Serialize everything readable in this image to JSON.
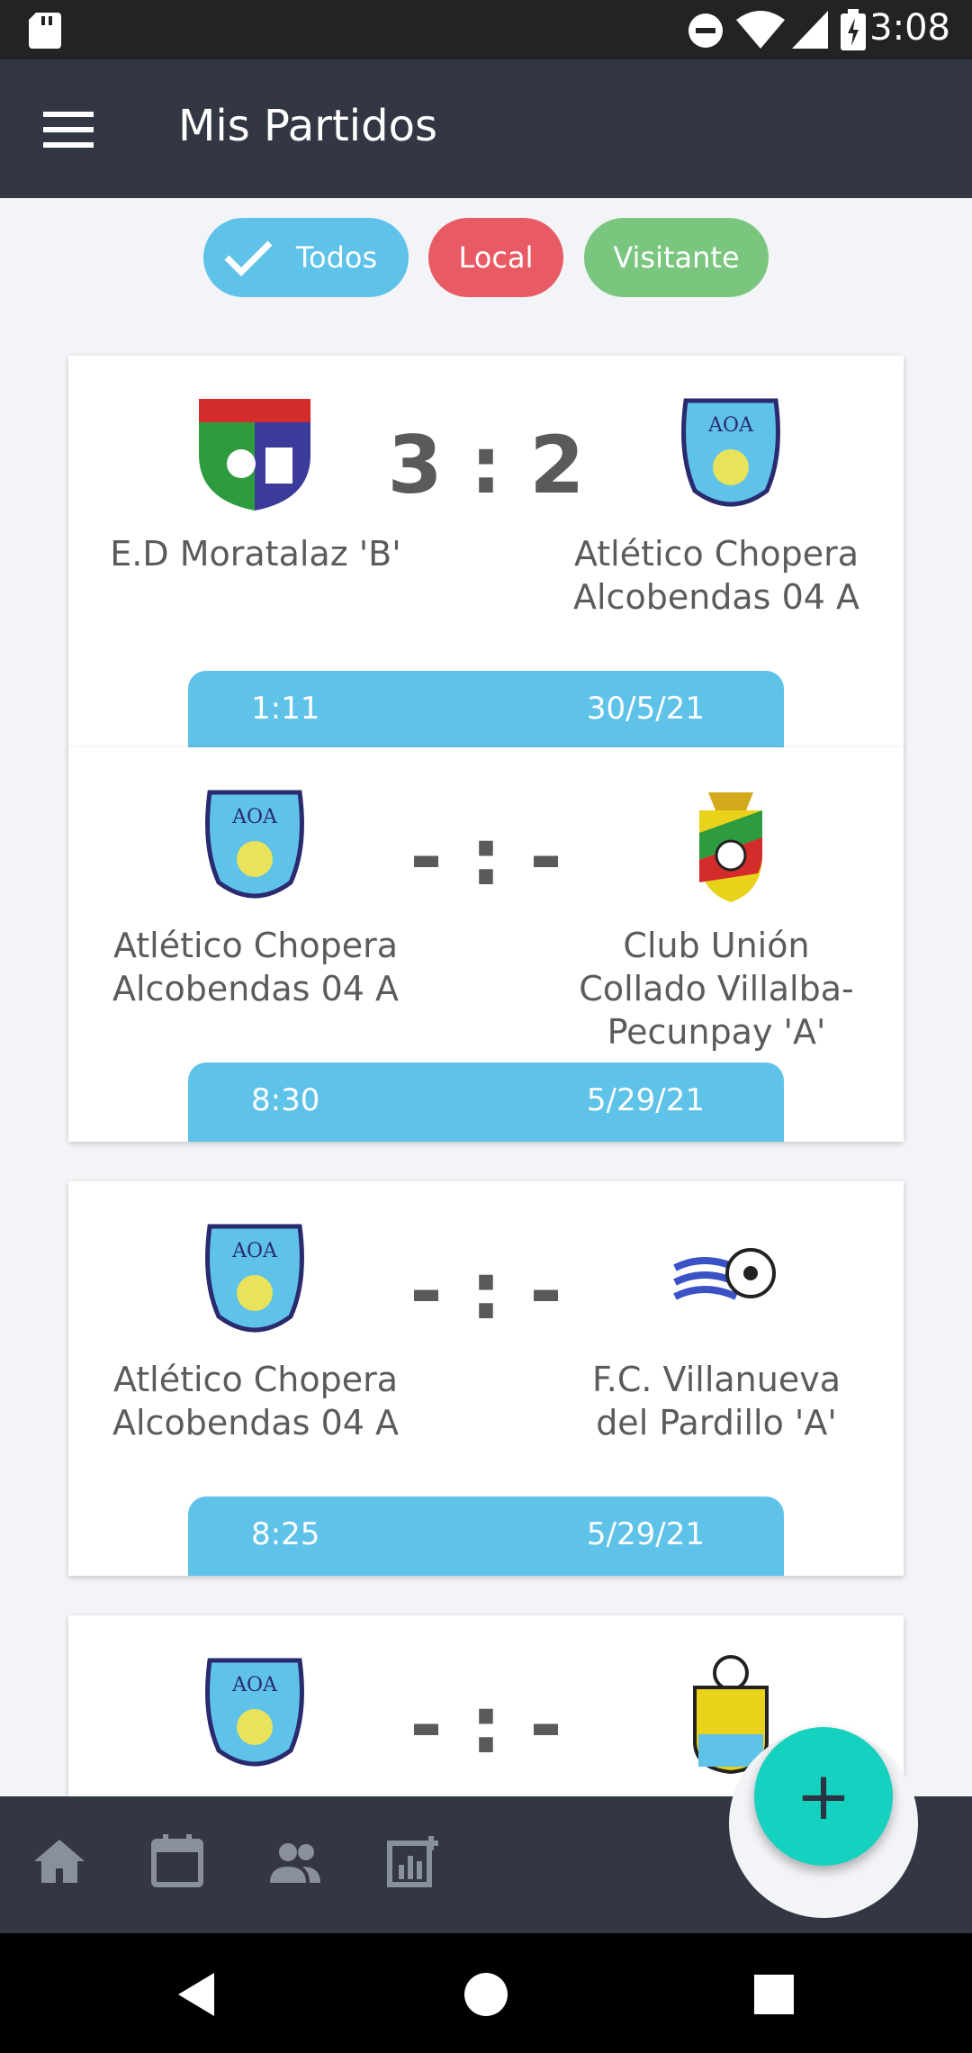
{
  "status": {
    "time": "3:08"
  },
  "header": {
    "title": "Mis Partidos"
  },
  "filters": {
    "todos": "Todos",
    "local": "Local",
    "visitante": "Visitante"
  },
  "matches": [
    {
      "home": "E.D Moratalaz 'B'",
      "away": "Atlético Chopera Alcobendas 04 A",
      "score": "3 : 2",
      "time": "1:11",
      "date": "30/5/21"
    },
    {
      "home": "Atlético Chopera Alcobendas 04 A",
      "away": "Club Unión Collado Villalba-Pecunpay 'A'",
      "score": "- : -",
      "time": "8:30",
      "date": "5/29/21"
    },
    {
      "home": "Atlético Chopera Alcobendas 04 A",
      "away": "F.C. Villanueva del Pardillo 'A'",
      "score": "- : -",
      "time": "8:25",
      "date": "5/29/21"
    },
    {
      "home": "",
      "away": "",
      "score": "- : -",
      "time": "",
      "date": ""
    }
  ],
  "fab": {
    "label": "+"
  },
  "colors": {
    "accent": "#5ec2e9",
    "local": "#e85a64",
    "visitante": "#7bc67e",
    "fab": "#15d1bf",
    "bar": "#323743"
  }
}
